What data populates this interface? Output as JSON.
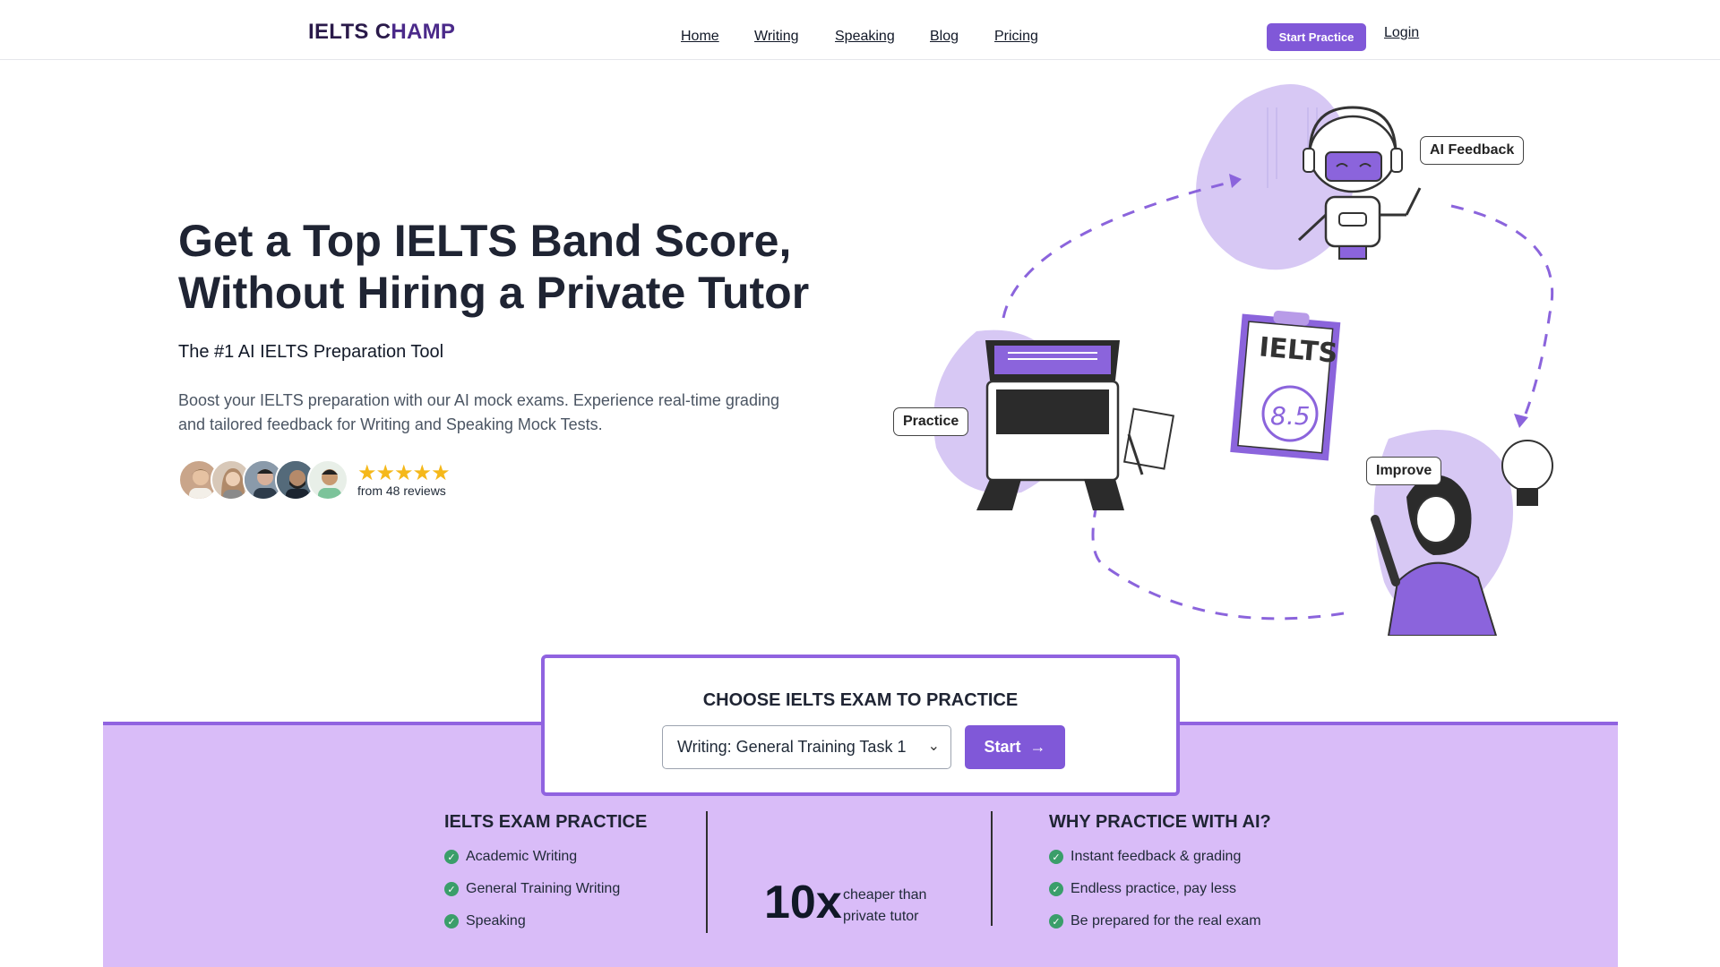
{
  "header": {
    "logo_part1": "IELTS C",
    "logo_part2": "HAMP",
    "nav": [
      "Home",
      "Writing",
      "Speaking",
      "Blog",
      "Pricing"
    ],
    "cta": "Start Practice",
    "login": "Login"
  },
  "hero": {
    "title_line1": "Get a Top IELTS Band Score,",
    "title_line2": "Without Hiring a Private Tutor",
    "subtitle": "The #1 AI IELTS Preparation Tool",
    "description": "Boost your IELTS preparation with our AI mock exams. Experience real-time grading and tailored feedback for Writing and Speaking Mock Tests.",
    "rating_stars": 5,
    "reviews_text": "from 48 reviews"
  },
  "illustration": {
    "labels": {
      "ai_feedback": "AI Feedback",
      "practice": "Practice",
      "improve": "Improve"
    },
    "clipboard_title": "IELTS",
    "clipboard_score": "8.5"
  },
  "exam_chooser": {
    "title": "CHOOSE IELTS EXAM TO PRACTICE",
    "selected": "Writing: General Training Task 1",
    "start": "Start"
  },
  "practice_col": {
    "heading": "IELTS EXAM PRACTICE",
    "items": [
      "Academic Writing",
      "General Training Writing",
      "Speaking"
    ]
  },
  "comparison": {
    "value": "10x",
    "line1": "cheaper than",
    "line2": "private tutor"
  },
  "why_col": {
    "heading": "WHY PRACTICE WITH AI?",
    "items": [
      "Instant feedback & grading",
      "Endless practice, pay less",
      "Be prepared for the real exam"
    ]
  },
  "colors": {
    "accent": "#8058d8",
    "band": "#d9bcf8",
    "check": "#3a9e6a",
    "star": "#f5b81a"
  }
}
